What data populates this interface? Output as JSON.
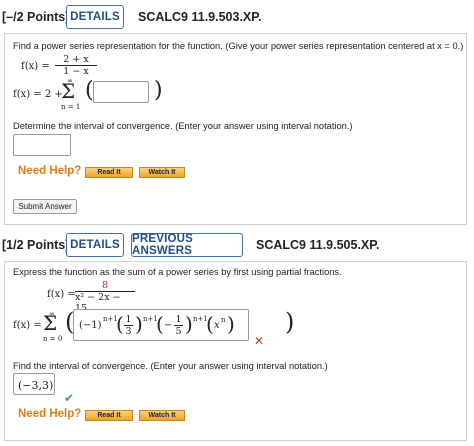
{
  "q1": {
    "points": "[–/2 Points]",
    "details_label": "DETAILS",
    "code": "SCALC9 11.9.503.XP.",
    "prompt": "Find a power series representation for the function. (Give your power series representation centered at x = 0.)",
    "fx_label": "f(x) =",
    "fx_num": "2 + x",
    "fx_den": "1 − x",
    "series_lhs": "f(x) = 2 +",
    "sum_upper": "∞",
    "sum_lower": "n = 1",
    "series_answer": "",
    "interval_prompt": "Determine the interval of convergence. (Enter your answer using interval notation.)",
    "interval_answer": "",
    "need_help": "Need Help?",
    "read_it": "Read It",
    "watch_it": "Watch It",
    "submit": "Submit Answer"
  },
  "q2": {
    "points": "[1/2 Points]",
    "details_label": "DETAILS",
    "previous_label": "PREVIOUS ANSWERS",
    "code": "SCALC9 11.9.505.XP.",
    "prompt": "Express the function as the sum of a power series by first using partial fractions.",
    "fx_label": "f(x) =",
    "fx_num": "8",
    "fx_den": "x² − 2x − 15",
    "series_lhs": "f(x) =",
    "sum_upper": "∞",
    "sum_lower": "n = 0",
    "term_a": "(−1)",
    "exp_a": "n+1",
    "frac1_num": "1",
    "frac1_den": "3",
    "exp_b": "n+1",
    "term_c": "−",
    "frac2_num": "1",
    "frac2_den": "5",
    "exp_c": "n+1",
    "term_x": "x",
    "exp_x": "n",
    "wrong_mark": "✕",
    "interval_prompt": "Find the interval of convergence. (Enter your answer using interval notation.)",
    "interval_answer": "(−3,3)",
    "correct_mark": "✔",
    "need_help": "Need Help?",
    "read_it": "Read It",
    "watch_it": "Watch It"
  },
  "colors": {
    "accent": "#1f4e87",
    "help": "#e07b1a",
    "wrong": "#d9302c",
    "correct": "#4aa04a"
  }
}
